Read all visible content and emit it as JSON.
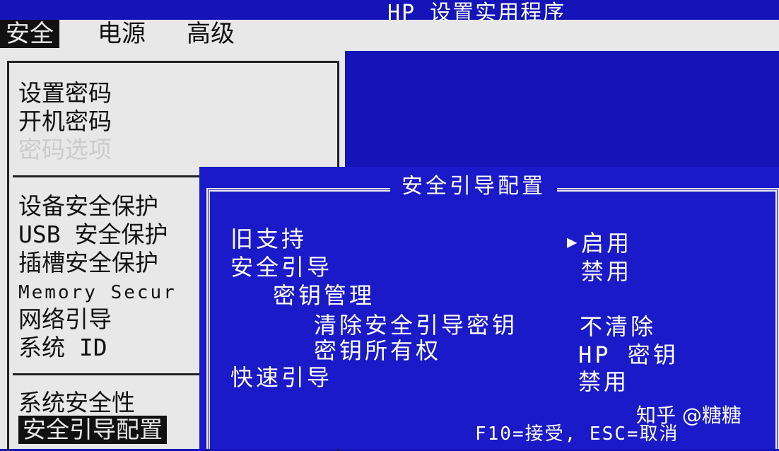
{
  "window": {
    "title": "HP 设置实用程序"
  },
  "menubar": {
    "items": [
      {
        "label": "安全",
        "active": true
      },
      {
        "label": "电源",
        "active": false
      },
      {
        "label": "高级",
        "active": false
      }
    ]
  },
  "left_menu": {
    "group1": [
      "设置密码",
      "开机密码",
      "密码选项"
    ],
    "group2": [
      "设备安全保护",
      "USB 安全保护",
      "插槽安全保护",
      "Memory Secur",
      "网络引导",
      "系统 ID"
    ],
    "group3": [
      "系统安全性",
      "安全引导配置"
    ]
  },
  "dialog": {
    "title": "安全引导配置",
    "rows": [
      {
        "label": "旧支持",
        "value": "启用",
        "selected": true
      },
      {
        "label": "安全引导",
        "value": "禁用"
      },
      {
        "label": "密钥管理",
        "value": ""
      },
      {
        "label": "清除安全引导密钥",
        "value": "不清除"
      },
      {
        "label": "密钥所有权",
        "value": "HP 密钥"
      },
      {
        "label": "快速引导",
        "value": "禁用"
      }
    ],
    "footer": "F10=接受, ESC=取消"
  },
  "watermark": "知乎 @糖糖",
  "colors": {
    "bios_blue": "#1414b8",
    "panel_gray": "#e8e8e8",
    "text_dark": "#111111"
  }
}
